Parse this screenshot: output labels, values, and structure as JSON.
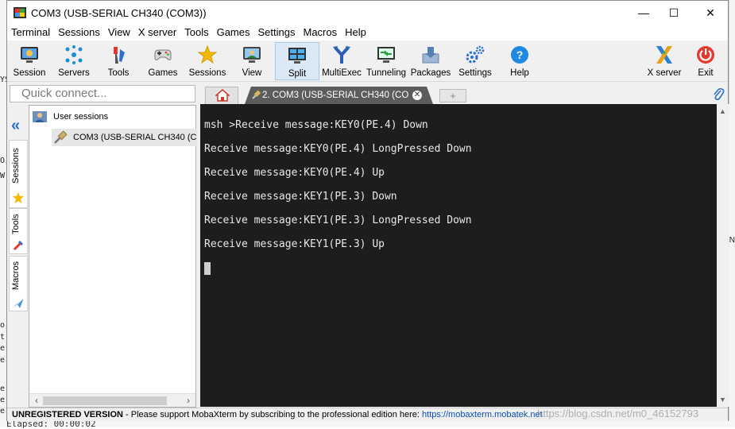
{
  "window": {
    "title": "COM3  (USB-SERIAL CH340 (COM3))",
    "controls": {
      "minimize": "—",
      "maximize": "☐",
      "close": "✕"
    }
  },
  "menu": [
    "Terminal",
    "Sessions",
    "View",
    "X server",
    "Tools",
    "Games",
    "Settings",
    "Macros",
    "Help"
  ],
  "toolbar": [
    {
      "label": "Session",
      "icon": "session-icon"
    },
    {
      "label": "Servers",
      "icon": "servers-icon"
    },
    {
      "label": "Tools",
      "icon": "tools-icon"
    },
    {
      "label": "Games",
      "icon": "games-icon"
    },
    {
      "label": "Sessions",
      "icon": "star-icon"
    },
    {
      "label": "View",
      "icon": "view-icon"
    },
    {
      "label": "Split",
      "icon": "split-icon",
      "active": true
    },
    {
      "label": "MultiExec",
      "icon": "multiexec-icon"
    },
    {
      "label": "Tunneling",
      "icon": "tunneling-icon"
    },
    {
      "label": "Packages",
      "icon": "packages-icon"
    },
    {
      "label": "Settings",
      "icon": "settings-icon"
    },
    {
      "label": "Help",
      "icon": "help-icon"
    },
    {
      "label": "X server",
      "icon": "x-server-icon"
    },
    {
      "label": "Exit",
      "icon": "power-icon"
    }
  ],
  "quick_connect": {
    "placeholder": "Quick connect..."
  },
  "tabs": {
    "active_label": "2. COM3  (USB-SERIAL CH340 (CO",
    "close_glyph": "✕",
    "new_tab_glyph": "+"
  },
  "side_tabs": [
    "Sessions",
    "Tools",
    "Macros"
  ],
  "sessions_tree": {
    "root": "User sessions",
    "items": [
      "COM3  (USB-SERIAL CH340 (CO"
    ]
  },
  "terminal": {
    "lines": [
      "msh >Receive message:KEY0(PE.4) Down",
      "Receive message:KEY0(PE.4) LongPressed Down",
      "Receive message:KEY0(PE.4) Up",
      "Receive message:KEY1(PE.3) Down",
      "Receive message:KEY1(PE.3) LongPressed Down",
      "Receive message:KEY1(PE.3) Up"
    ]
  },
  "status": {
    "unregistered": "UNREGISTERED VERSION",
    "message": "  -  Please support MobaXterm by subscribing to the professional edition here:  ",
    "link": "https://mobaxterm.mobatek.net"
  },
  "watermark": "https://blog.csdn.net/m0_46152793",
  "background": {
    "left_fragments": [
      "YS",
      "O",
      "W",
      "o",
      "t",
      "e",
      "e",
      "e",
      "e",
      "e"
    ],
    "right_fragment": "N",
    "bottom_text": "Elapsed:  00:00:02"
  },
  "colors": {
    "terminal_bg": "#1d1d1d",
    "terminal_fg": "#e8e8e8",
    "active_tab_bg": "#5c5c5c",
    "accent_blue": "#2a6fd0",
    "exit_red": "#e23b2e"
  }
}
